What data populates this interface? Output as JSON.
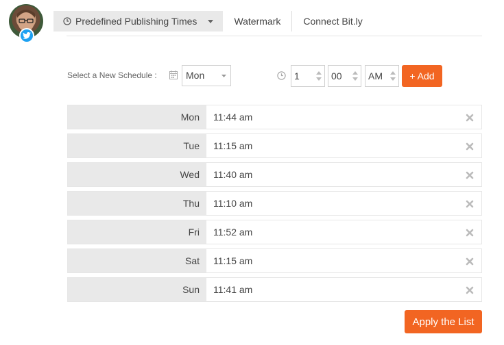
{
  "tabs": [
    {
      "label": "Predefined Publishing Times",
      "active": true
    },
    {
      "label": "Watermark"
    },
    {
      "label": "Connect Bit.ly"
    }
  ],
  "schedule": {
    "label": "Select a New Schedule :",
    "day_value": "Mon",
    "hour_value": "1",
    "minute_value": "00",
    "ampm_value": "AM",
    "add_label": "+ Add"
  },
  "rows": [
    {
      "day": "Mon",
      "time": "11:44 am"
    },
    {
      "day": "Tue",
      "time": "11:15 am"
    },
    {
      "day": "Wed",
      "time": "11:40 am"
    },
    {
      "day": "Thu",
      "time": "11:10 am"
    },
    {
      "day": "Fri",
      "time": "11:52 am"
    },
    {
      "day": "Sat",
      "time": "11:15 am"
    },
    {
      "day": "Sun",
      "time": "11:41 am"
    }
  ],
  "apply_label": "Apply the List",
  "colors": {
    "accent": "#f26522",
    "twitter": "#1da1f2",
    "day_cell_bg": "#e9e9e9"
  },
  "icons": {
    "avatar_badge": "twitter-icon",
    "tab_icon": "clock-icon",
    "tab_caret": "caret-down-icon",
    "calendar": "calendar-icon",
    "time": "clock-icon",
    "remove": "close-icon"
  }
}
